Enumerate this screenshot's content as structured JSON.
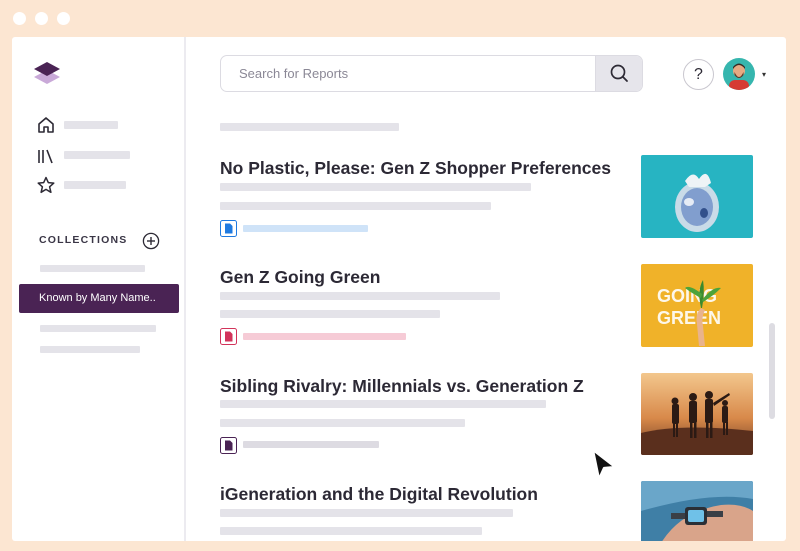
{
  "search": {
    "placeholder": "Search for Reports"
  },
  "header": {
    "help_label": "?",
    "caret": "▾"
  },
  "icons": {
    "logo": "layers-logo-icon",
    "home": "home-icon",
    "library": "library-icon",
    "favorites": "star-icon",
    "add": "plus-circle-icon",
    "search": "search-icon",
    "cursor": "arrow-cursor-icon"
  },
  "sidebar": {
    "collections_label": "COLLECTIONS",
    "active_collection": "Known by Many Name.."
  },
  "reports": [
    {
      "title": "No Plastic, Please: Gen Z Shopper Preferences",
      "type_color": "#1f7ae0"
    },
    {
      "title": "Gen Z Going Green",
      "type_color": "#d2335a"
    },
    {
      "title": "Sibling Rivalry: Millennials vs. Generation Z",
      "type_color": "#4a2354"
    },
    {
      "title": "iGeneration and the Digital Revolution"
    }
  ],
  "thumbnails": [
    {
      "alt": "plastic bag",
      "text": ""
    },
    {
      "alt": "hand holding plant",
      "text": "GOING GREEN"
    },
    {
      "alt": "family at sunset",
      "text": ""
    },
    {
      "alt": "smartwatch",
      "text": ""
    }
  ],
  "colors": {
    "accent_purple": "#4a2354",
    "frame": "#fce6d2",
    "placeholder_bar": "#e4e3e9"
  }
}
